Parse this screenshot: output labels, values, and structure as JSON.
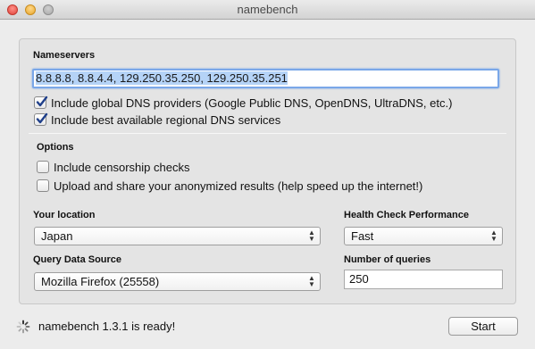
{
  "window": {
    "title": "namebench"
  },
  "nameservers": {
    "label": "Nameservers",
    "value": "8.8.8.8, 8.8.4.4, 129.250.35.250, 129.250.35.251",
    "include_global": {
      "label": "Include global DNS providers (Google Public DNS, OpenDNS, UltraDNS, etc.)",
      "checked": true
    },
    "include_regional": {
      "label": "Include best available regional DNS services",
      "checked": true
    }
  },
  "options": {
    "label": "Options",
    "censorship": {
      "label": "Include censorship checks",
      "checked": false
    },
    "upload": {
      "label": "Upload and share your anonymized results (help speed up the internet!)",
      "checked": false
    }
  },
  "location": {
    "label": "Your location",
    "selected": "Japan"
  },
  "health_check": {
    "label": "Health Check Performance",
    "selected": "Fast"
  },
  "query_source": {
    "label": "Query Data Source",
    "selected": "Mozilla Firefox (25558)"
  },
  "num_queries": {
    "label": "Number of queries",
    "value": "250"
  },
  "status": {
    "text": "namebench 1.3.1 is ready!",
    "icon": "spinner-icon"
  },
  "start_button": {
    "label": "Start"
  },
  "colors": {
    "checkmark": "#1f3f8a",
    "focus_ring": "#7aa7e8",
    "selection": "#b5d3f7"
  }
}
